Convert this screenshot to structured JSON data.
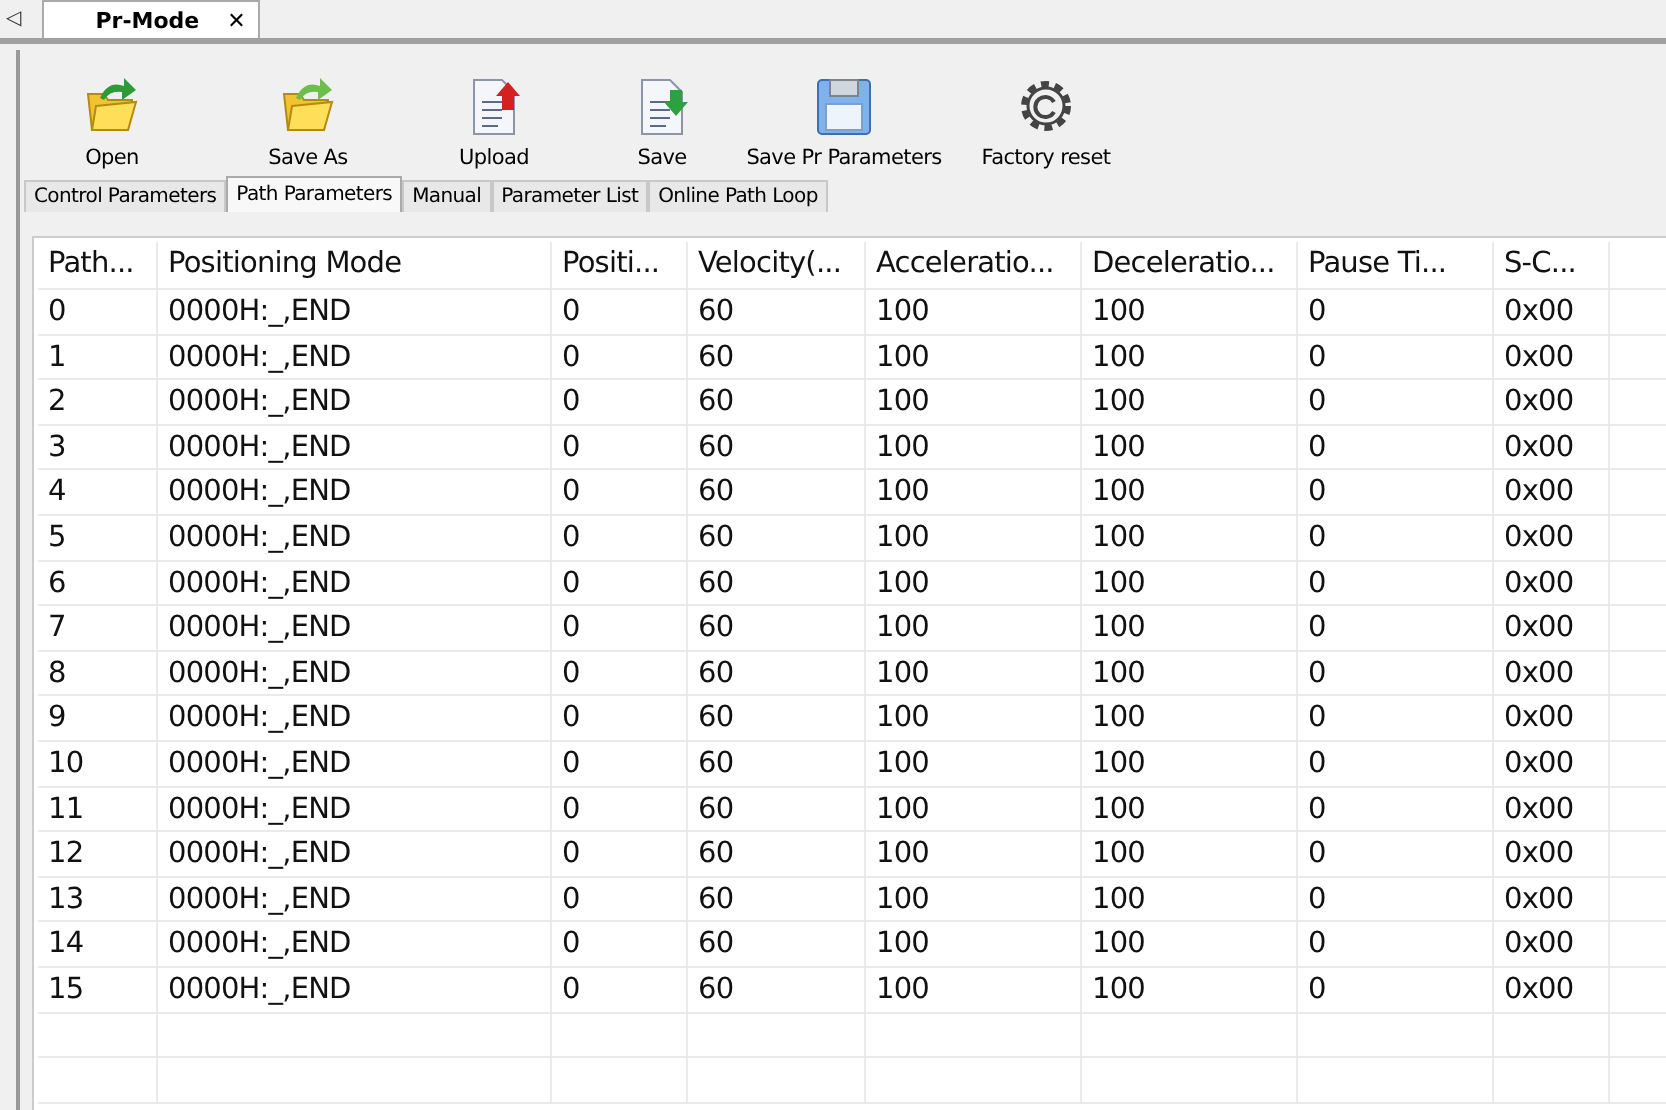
{
  "doc_tab": {
    "label": "Pr-Mode",
    "close": "✕"
  },
  "nav_arrow": "◁",
  "toolbar": [
    {
      "label": "Open",
      "kind": "open"
    },
    {
      "label": "Save As",
      "kind": "saveas"
    },
    {
      "label": "Upload",
      "kind": "upload"
    },
    {
      "label": "Save",
      "kind": "save"
    },
    {
      "label": "Save Pr Parameters",
      "kind": "disk"
    },
    {
      "label": "Factory reset",
      "kind": "gear"
    }
  ],
  "tabs": [
    {
      "label": "Control Parameters",
      "selected": false
    },
    {
      "label": "Path Parameters",
      "selected": true
    },
    {
      "label": "Manual",
      "selected": false
    },
    {
      "label": "Parameter List",
      "selected": false
    },
    {
      "label": "Online Path Loop",
      "selected": false
    }
  ],
  "table": {
    "columns": [
      "Path...",
      "Positioning Mode",
      "Positi...",
      "Velocity(...",
      "Acceleratio...",
      "Deceleratio...",
      "Pause Ti...",
      "S-C..."
    ],
    "rows": [
      [
        "0",
        "0000H:_,END",
        "0",
        "60",
        "100",
        "100",
        "0",
        "0x00"
      ],
      [
        "1",
        "0000H:_,END",
        "0",
        "60",
        "100",
        "100",
        "0",
        "0x00"
      ],
      [
        "2",
        "0000H:_,END",
        "0",
        "60",
        "100",
        "100",
        "0",
        "0x00"
      ],
      [
        "3",
        "0000H:_,END",
        "0",
        "60",
        "100",
        "100",
        "0",
        "0x00"
      ],
      [
        "4",
        "0000H:_,END",
        "0",
        "60",
        "100",
        "100",
        "0",
        "0x00"
      ],
      [
        "5",
        "0000H:_,END",
        "0",
        "60",
        "100",
        "100",
        "0",
        "0x00"
      ],
      [
        "6",
        "0000H:_,END",
        "0",
        "60",
        "100",
        "100",
        "0",
        "0x00"
      ],
      [
        "7",
        "0000H:_,END",
        "0",
        "60",
        "100",
        "100",
        "0",
        "0x00"
      ],
      [
        "8",
        "0000H:_,END",
        "0",
        "60",
        "100",
        "100",
        "0",
        "0x00"
      ],
      [
        "9",
        "0000H:_,END",
        "0",
        "60",
        "100",
        "100",
        "0",
        "0x00"
      ],
      [
        "10",
        "0000H:_,END",
        "0",
        "60",
        "100",
        "100",
        "0",
        "0x00"
      ],
      [
        "11",
        "0000H:_,END",
        "0",
        "60",
        "100",
        "100",
        "0",
        "0x00"
      ],
      [
        "12",
        "0000H:_,END",
        "0",
        "60",
        "100",
        "100",
        "0",
        "0x00"
      ],
      [
        "13",
        "0000H:_,END",
        "0",
        "60",
        "100",
        "100",
        "0",
        "0x00"
      ],
      [
        "14",
        "0000H:_,END",
        "0",
        "60",
        "100",
        "100",
        "0",
        "0x00"
      ],
      [
        "15",
        "0000H:_,END",
        "0",
        "60",
        "100",
        "100",
        "0",
        "0x00"
      ]
    ]
  }
}
